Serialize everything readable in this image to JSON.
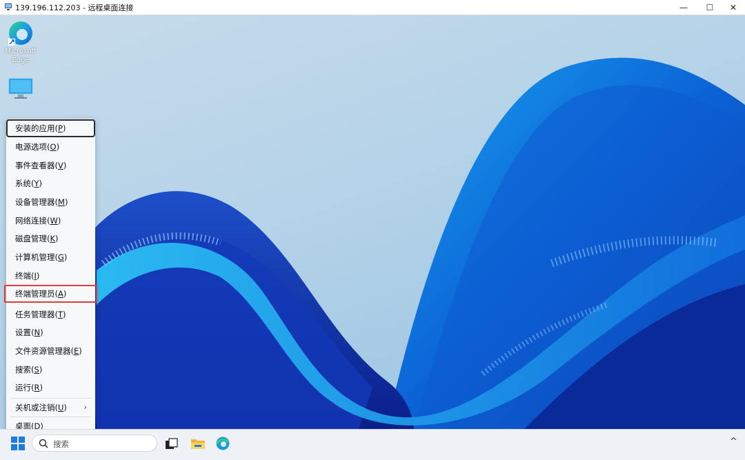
{
  "window": {
    "title": "139.196.112.203 - 远程桌面连接",
    "controls": {
      "minimize": "—",
      "maximize": "☐",
      "close": "✕"
    }
  },
  "desktop": {
    "icons": [
      {
        "label": "Microsoft\nEdge",
        "icon": "edge-icon"
      },
      {
        "label": "",
        "icon": "this-pc-icon"
      }
    ]
  },
  "context_menu": {
    "items": [
      {
        "text": "安装的应用(",
        "key": "P",
        "tail": ")"
      },
      {
        "text": "电源选项(",
        "key": "O",
        "tail": ")"
      },
      {
        "text": "事件查看器(",
        "key": "V",
        "tail": ")"
      },
      {
        "text": "系统(",
        "key": "Y",
        "tail": ")"
      },
      {
        "text": "设备管理器(",
        "key": "M",
        "tail": ")"
      },
      {
        "text": "网络连接(",
        "key": "W",
        "tail": ")"
      },
      {
        "text": "磁盘管理(",
        "key": "K",
        "tail": ")"
      },
      {
        "text": "计算机管理(",
        "key": "G",
        "tail": ")"
      },
      {
        "text": "终端(",
        "key": "I",
        "tail": ")"
      },
      {
        "text": "终端管理员(",
        "key": "A",
        "tail": ")"
      },
      {
        "text": "任务管理器(",
        "key": "T",
        "tail": ")"
      },
      {
        "text": "设置(",
        "key": "N",
        "tail": ")"
      },
      {
        "text": "文件资源管理器(",
        "key": "E",
        "tail": ")"
      },
      {
        "text": "搜索(",
        "key": "S",
        "tail": ")"
      },
      {
        "text": "运行(",
        "key": "R",
        "tail": ")"
      },
      {
        "text": "关机或注销(",
        "key": "U",
        "tail": ")",
        "submenu_glyph": "›"
      },
      {
        "text": "桌面(",
        "key": "D",
        "tail": ")"
      }
    ],
    "focused_item": "安装的应用(P)",
    "highlighted_item": "终端管理员(A)",
    "highlight_color": "#e03b3b"
  },
  "taskbar": {
    "search_placeholder": "搜索",
    "tray_glyph": "^"
  },
  "colors": {
    "accent": "#1e6fd9",
    "taskbar_bg": "#eef2f7",
    "menu_bg": "#f7f8fa"
  }
}
